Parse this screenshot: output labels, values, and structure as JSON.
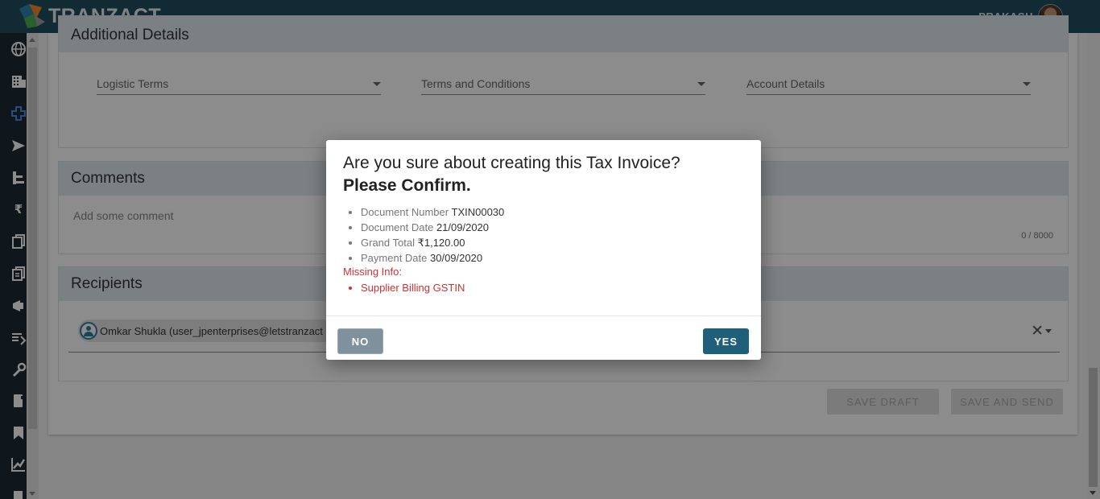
{
  "header": {
    "brand": "TRANZACT",
    "user_name": "PRAKASH"
  },
  "sidebar": {
    "icons": [
      "globe-icon",
      "building-icon",
      "plus-icon",
      "send-icon",
      "list-icon",
      "rupee-icon",
      "documents-icon",
      "copy-icon",
      "megaphone-icon",
      "transfer-icon",
      "wrench-icon",
      "book-icon",
      "bookmark-icon",
      "chart-icon",
      "folder-icon"
    ],
    "active_index": 2
  },
  "additional_details": {
    "title": "Additional Details",
    "fields": [
      "Logistic Terms",
      "Terms and Conditions",
      "Account Details"
    ]
  },
  "comments": {
    "title": "Comments",
    "placeholder": "Add some comment",
    "char_count": "0 / 8000"
  },
  "recipients": {
    "title": "Recipients",
    "chip": "Omkar Shukla (user_jpenterprises@letstranzact"
  },
  "actions": {
    "save_draft": "SAVE DRAFT",
    "save_and_send": "SAVE AND SEND"
  },
  "dialog": {
    "title": "Are you sure about creating this Tax Invoice?",
    "confirm": "Please Confirm.",
    "items": [
      {
        "label": "Document Number",
        "value": "TXIN00030"
      },
      {
        "label": "Document Date",
        "value": "21/09/2020"
      },
      {
        "label": "Grand Total",
        "value": "₹1,120.00"
      },
      {
        "label": "Payment Date",
        "value": "30/09/2020"
      }
    ],
    "missing_label": "Missing Info:",
    "missing_items": [
      "Supplier Billing GSTIN"
    ],
    "no_label": "NO",
    "yes_label": "YES"
  },
  "colors": {
    "header_bg": "#1f4e5f",
    "nav_bg": "#1c2a33",
    "primary": "#1f5f7a",
    "error": "#d32f2f"
  }
}
